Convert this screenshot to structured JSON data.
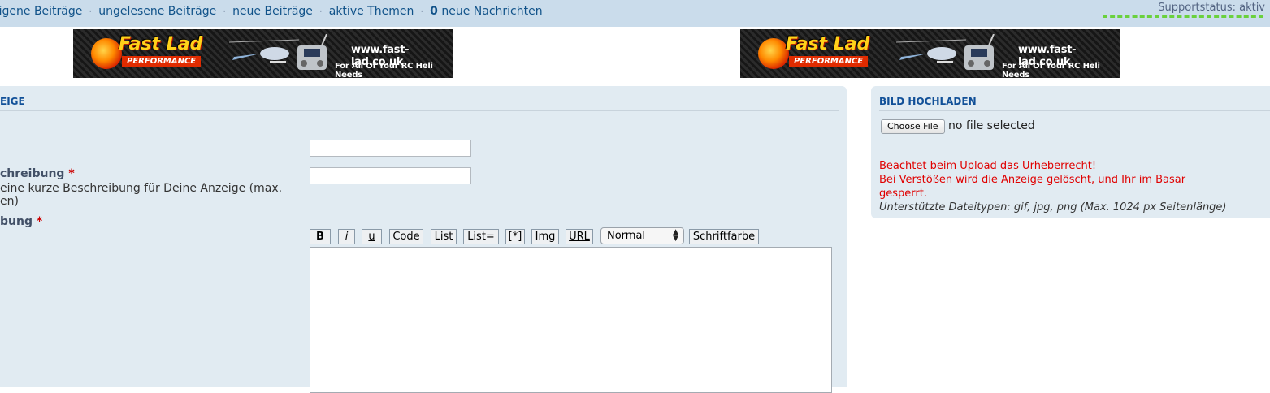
{
  "nav": {
    "links": [
      "eigene Beiträge",
      "ungelesene Beiträge",
      "neue Beiträge",
      "aktive Themen"
    ],
    "separator": "·",
    "messages_count": "0",
    "messages_label": "neue Nachrichten",
    "support_status": "Supportstatus: aktiv"
  },
  "banner": {
    "brand": "Fast Lad",
    "sub": "PERFORMANCE",
    "url": "www.fast-lad.co.uk",
    "tagline": "For All Of Your RC Heli Needs"
  },
  "form": {
    "heading": "EIGE",
    "short_label": "chreibung",
    "short_hint_line1": "eine kurze Beschreibung für Deine Anzeige (max.",
    "short_hint_line2": "en)",
    "desc_label": "bung",
    "required_mark": "*",
    "toolbar": {
      "bold": "B",
      "italic": "i",
      "underline": "u",
      "code": "Code",
      "list": "List",
      "list_ordered": "List=",
      "list_item": "[*]",
      "img": "Img",
      "url": "URL",
      "size_value": "Normal",
      "color": "Schriftfarbe"
    }
  },
  "upload": {
    "heading": "BILD HOCHLADEN",
    "choose_button": "Choose File",
    "file_status": "no file selected",
    "warning_1": "Beachtet beim Upload das Urheberrecht!",
    "warning_2": "Bei Verstößen wird die Anzeige gelöscht, und Ihr im Basar",
    "warning_3": "gesperrt.",
    "file_types": "Unterstützte Dateitypen: gif, jpg, png (Max. 1024 px Seitenlänge)"
  }
}
